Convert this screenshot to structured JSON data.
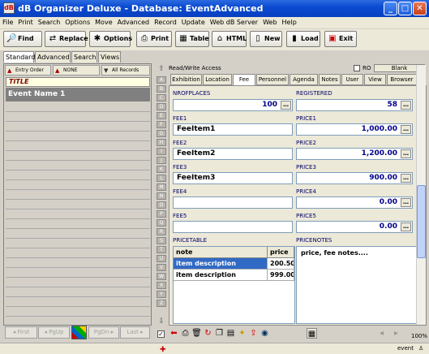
{
  "window": {
    "title": "dB Organizer Deluxe - Database: EventAdvanced",
    "min": "_",
    "max": "□",
    "close": "✕"
  },
  "menu": [
    "File",
    "Print",
    "Search",
    "Options",
    "Move",
    "Advanced",
    "Record",
    "Update",
    "Web dB Server",
    "Web",
    "Help"
  ],
  "toolbar": [
    {
      "label": "Find",
      "icon": "🔎"
    },
    {
      "label": "Replace",
      "icon": "⇄"
    },
    {
      "label": "Options",
      "icon": "✱"
    },
    {
      "label": "Print",
      "icon": "⎙"
    },
    {
      "label": "Table",
      "icon": "▦"
    },
    {
      "label": "HTML",
      "icon": "⌂"
    },
    {
      "label": "New",
      "icon": "▯"
    },
    {
      "label": "Load",
      "icon": "▮"
    },
    {
      "label": "Exit",
      "icon": "▣"
    }
  ],
  "view_tabs": [
    "Standard",
    "Advanced",
    "Search",
    "Views"
  ],
  "left": {
    "sort_buttons": [
      "Entry Order",
      "NONE",
      "All Records"
    ],
    "header_label": "TITLE",
    "selected_record": "Event Name 1",
    "nav": [
      "First",
      "PgUp",
      "PgDn",
      "Last"
    ]
  },
  "alphabet": [
    "A",
    "B",
    "C",
    "D",
    "E",
    "F",
    "G",
    "H",
    "I",
    "J",
    "K",
    "L",
    "M",
    "N",
    "O",
    "P",
    "Q",
    "R",
    "S",
    "T",
    "U",
    "V",
    "W",
    "X",
    "Y",
    "Z"
  ],
  "right": {
    "access": "Read/Write Access",
    "ro_label": "RO",
    "blank_button": "Blank",
    "tabs": [
      "Exhibition",
      "Location",
      "Fee",
      "Personnel",
      "Agenda",
      "Notes",
      "User",
      "View",
      "Browser"
    ],
    "selected_tab": "Fee",
    "fields": {
      "nrofplaces": {
        "label": "NROFPLACES",
        "value": "100"
      },
      "registered": {
        "label": "REGISTERED",
        "value": "58"
      },
      "fee1": {
        "label": "FEE1",
        "value": "FeeItem1"
      },
      "price1": {
        "label": "PRICE1",
        "value": "1,000.00"
      },
      "fee2": {
        "label": "FEE2",
        "value": "FeeItem2"
      },
      "price2": {
        "label": "PRICE2",
        "value": "1,200.00"
      },
      "fee3": {
        "label": "FEE3",
        "value": "FeeItem3"
      },
      "price3": {
        "label": "PRICE3",
        "value": "900.00"
      },
      "fee4": {
        "label": "FEE4",
        "value": ""
      },
      "price4": {
        "label": "PRICE4",
        "value": "0.00"
      },
      "fee5": {
        "label": "FEE5",
        "value": ""
      },
      "price5": {
        "label": "PRICE5",
        "value": "0.00"
      }
    },
    "pricetable": {
      "label": "PRICETABLE",
      "columns": [
        "note",
        "price"
      ],
      "rows": [
        [
          "item description",
          "200.50"
        ],
        [
          "item description",
          "999.00"
        ]
      ]
    },
    "pricenotes": {
      "label": "PRICENOTES",
      "value": "price, fee notes...."
    }
  },
  "zoom": "100%",
  "status": {
    "text": "event"
  },
  "colors": {
    "titlebar": "#0b4bd1",
    "selection": "#316ac5",
    "value_text": "#00008b"
  }
}
